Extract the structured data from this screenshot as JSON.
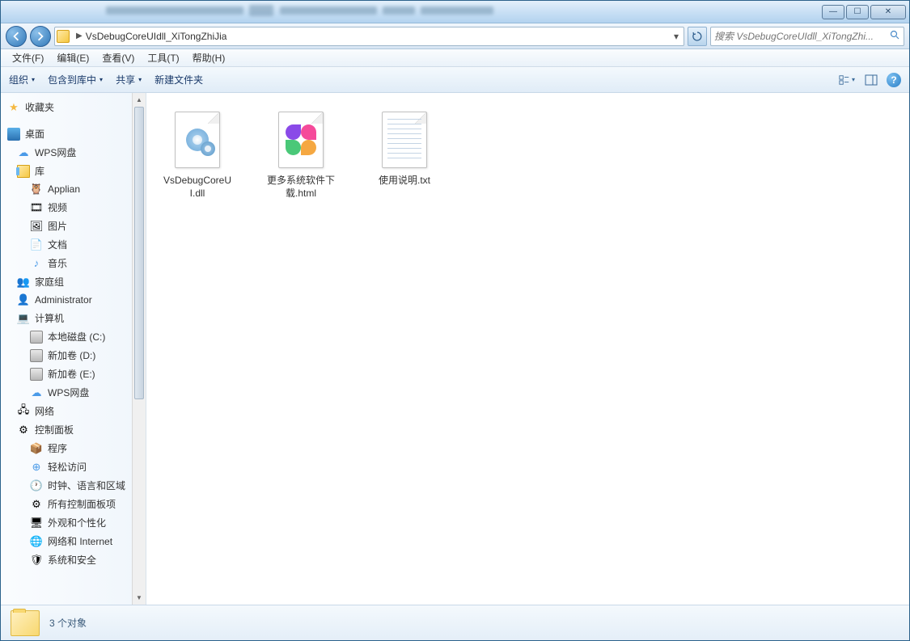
{
  "titlebar": {
    "minimize": "—",
    "maximize": "☐",
    "close": "✕"
  },
  "addressbar": {
    "path": "VsDebugCoreUIdll_XiTongZhiJia",
    "chevron": "▶",
    "dropdown": "▾",
    "refresh": "↻"
  },
  "search": {
    "placeholder": "搜索 VsDebugCoreUIdll_XiTongZhi..."
  },
  "menubar": {
    "file": "文件(F)",
    "edit": "编辑(E)",
    "view": "查看(V)",
    "tools": "工具(T)",
    "help": "帮助(H)"
  },
  "toolbar": {
    "organize": "组织",
    "include": "包含到库中",
    "share": "共享",
    "newfolder": "新建文件夹",
    "help": "?"
  },
  "sidebar": {
    "favorites": "收藏夹",
    "desktop": "桌面",
    "wps1": "WPS网盘",
    "libraries": "库",
    "applian": "Applian",
    "videos": "视频",
    "pictures": "图片",
    "documents": "文档",
    "music": "音乐",
    "homegroup": "家庭组",
    "admin": "Administrator",
    "computer": "计算机",
    "diskc": "本地磁盘 (C:)",
    "diskd": "新加卷 (D:)",
    "diske": "新加卷 (E:)",
    "wps2": "WPS网盘",
    "network": "网络",
    "controlpanel": "控制面板",
    "programs": "程序",
    "ease": "轻松访问",
    "clock": "时钟、语言和区域",
    "allcp": "所有控制面板项",
    "appearance": "外观和个性化",
    "netinternet": "网络和 Internet",
    "syssec": "系统和安全"
  },
  "files": [
    {
      "name": "VsDebugCoreUI.dll",
      "type": "dll"
    },
    {
      "name": "更多系统软件下载.html",
      "type": "html"
    },
    {
      "name": "使用说明.txt",
      "type": "txt"
    }
  ],
  "statusbar": {
    "text": "3 个对象"
  }
}
